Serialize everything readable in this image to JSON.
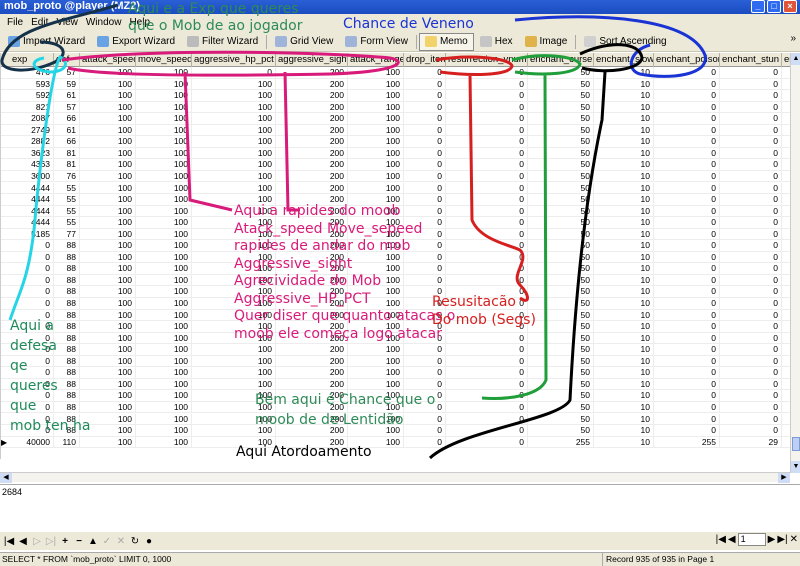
{
  "window": {
    "title": "mob_proto @player (MZ2)"
  },
  "menu": [
    "File",
    "Edit",
    "View",
    "Window",
    "Help"
  ],
  "toolbar": {
    "items": [
      "Import Wizard",
      "Export Wizard",
      "Filter Wizard",
      "Grid View",
      "Form View",
      "Memo",
      "Hex",
      "Image",
      "Sort Ascending"
    ],
    "chevron": "»"
  },
  "columns": [
    "exp",
    "def",
    "attack_speed",
    "move_speed",
    "aggressive_hp_pct",
    "aggressive_sight",
    "attack_range",
    "drop_item",
    "resurrection_vnum",
    "enchant_curse",
    "enchant_slow",
    "enchant_poison",
    "enchant_stun",
    "enc"
  ],
  "rows": [
    [
      "476",
      "57",
      "100",
      "100",
      "0",
      "200",
      "100",
      "0",
      "0",
      "50",
      "10",
      "0",
      "0"
    ],
    [
      "593",
      "59",
      "100",
      "100",
      "100",
      "200",
      "100",
      "0",
      "0",
      "50",
      "10",
      "0",
      "0"
    ],
    [
      "592",
      "61",
      "100",
      "100",
      "100",
      "200",
      "100",
      "0",
      "0",
      "50",
      "10",
      "0",
      "0"
    ],
    [
      "821",
      "57",
      "100",
      "100",
      "100",
      "200",
      "100",
      "0",
      "0",
      "50",
      "10",
      "0",
      "0"
    ],
    [
      "2087",
      "66",
      "100",
      "100",
      "100",
      "200",
      "100",
      "0",
      "0",
      "50",
      "10",
      "0",
      "0"
    ],
    [
      "2749",
      "61",
      "100",
      "100",
      "100",
      "200",
      "100",
      "0",
      "0",
      "50",
      "10",
      "0",
      "0"
    ],
    [
      "2882",
      "66",
      "100",
      "100",
      "100",
      "200",
      "100",
      "0",
      "0",
      "50",
      "10",
      "0",
      "0"
    ],
    [
      "3623",
      "81",
      "100",
      "100",
      "100",
      "200",
      "100",
      "0",
      "0",
      "50",
      "10",
      "0",
      "0"
    ],
    [
      "4363",
      "81",
      "100",
      "100",
      "100",
      "200",
      "100",
      "0",
      "0",
      "50",
      "10",
      "0",
      "0"
    ],
    [
      "3600",
      "76",
      "100",
      "100",
      "100",
      "200",
      "100",
      "0",
      "0",
      "50",
      "10",
      "0",
      "0"
    ],
    [
      "4444",
      "55",
      "100",
      "100",
      "100",
      "200",
      "100",
      "0",
      "0",
      "50",
      "10",
      "0",
      "0"
    ],
    [
      "4444",
      "55",
      "100",
      "100",
      "100",
      "200",
      "100",
      "0",
      "0",
      "50",
      "10",
      "0",
      "0"
    ],
    [
      "4444",
      "55",
      "100",
      "100",
      "100",
      "200",
      "100",
      "0",
      "0",
      "50",
      "10",
      "0",
      "0"
    ],
    [
      "4444",
      "55",
      "100",
      "100",
      "100",
      "200",
      "100",
      "0",
      "0",
      "50",
      "10",
      "0",
      "0"
    ],
    [
      "5185",
      "77",
      "100",
      "100",
      "100",
      "200",
      "100",
      "0",
      "0",
      "50",
      "10",
      "0",
      "0"
    ],
    [
      "0",
      "88",
      "100",
      "100",
      "100",
      "200",
      "100",
      "0",
      "0",
      "50",
      "10",
      "0",
      "0"
    ],
    [
      "0",
      "88",
      "100",
      "100",
      "100",
      "200",
      "100",
      "0",
      "0",
      "50",
      "10",
      "0",
      "0"
    ],
    [
      "0",
      "88",
      "100",
      "100",
      "100",
      "200",
      "100",
      "0",
      "0",
      "50",
      "10",
      "0",
      "0"
    ],
    [
      "0",
      "88",
      "100",
      "100",
      "100",
      "200",
      "100",
      "0",
      "0",
      "50",
      "10",
      "0",
      "0"
    ],
    [
      "0",
      "88",
      "100",
      "100",
      "100",
      "200",
      "100",
      "0",
      "0",
      "50",
      "10",
      "0",
      "0"
    ],
    [
      "0",
      "88",
      "100",
      "100",
      "100",
      "200",
      "100",
      "0",
      "0",
      "50",
      "10",
      "0",
      "0"
    ],
    [
      "0",
      "88",
      "100",
      "100",
      "100",
      "200",
      "100",
      "0",
      "0",
      "50",
      "10",
      "0",
      "0"
    ],
    [
      "0",
      "88",
      "100",
      "100",
      "100",
      "200",
      "100",
      "0",
      "0",
      "50",
      "10",
      "0",
      "0"
    ],
    [
      "0",
      "88",
      "100",
      "100",
      "100",
      "200",
      "100",
      "0",
      "0",
      "50",
      "10",
      "0",
      "0"
    ],
    [
      "0",
      "88",
      "100",
      "100",
      "100",
      "200",
      "100",
      "0",
      "0",
      "50",
      "10",
      "0",
      "0"
    ],
    [
      "0",
      "88",
      "100",
      "100",
      "100",
      "200",
      "100",
      "0",
      "0",
      "50",
      "10",
      "0",
      "0"
    ],
    [
      "0",
      "88",
      "100",
      "100",
      "100",
      "200",
      "100",
      "0",
      "0",
      "50",
      "10",
      "0",
      "0"
    ],
    [
      "0",
      "88",
      "100",
      "100",
      "100",
      "200",
      "100",
      "0",
      "0",
      "50",
      "10",
      "0",
      "0"
    ],
    [
      "0",
      "88",
      "100",
      "100",
      "100",
      "200",
      "100",
      "0",
      "0",
      "50",
      "10",
      "0",
      "0"
    ],
    [
      "0",
      "88",
      "100",
      "100",
      "100",
      "200",
      "100",
      "0",
      "0",
      "50",
      "10",
      "0",
      "0"
    ],
    [
      "0",
      "88",
      "100",
      "100",
      "100",
      "200",
      "100",
      "0",
      "0",
      "50",
      "10",
      "0",
      "0"
    ],
    [
      "0",
      "88",
      "100",
      "100",
      "100",
      "200",
      "100",
      "0",
      "0",
      "50",
      "10",
      "0",
      "0"
    ],
    [
      "40000",
      "110",
      "100",
      "100",
      "100",
      "200",
      "100",
      "0",
      "0",
      "255",
      "10",
      "255",
      "29"
    ]
  ],
  "memo": {
    "text": "2684"
  },
  "nav": {
    "page_input": "1"
  },
  "status": {
    "query": "SELECT * FROM `mob_proto` LIMIT 0, 1000",
    "record": "Record 935 of 935 in Page 1"
  },
  "annotations": {
    "exp": "Aqui e a Exp que queres\nque o Mob de ao jogador",
    "veneno": "Chance de Veneno",
    "rapides": "Aqui a rapides do moob\nAtack_speed Move_sepeed\nrapides de andar do mob\nAggressive_sight\nAgrecividade do Mob\nAggressive_HP_PCT\nQuer diser que quanto atacas o\nmoob ele começa logo atacar",
    "resusitacao": "Resusitacão\nDo mob (Segs)",
    "defesa": "Aqui a\ndefesa\nqe\nqueres\nque\nmob ten ha",
    "lentidao": "Bem aqui é Chance que o\nmoob de de Lentidão",
    "atordoamento": "Aqui Atordoamento"
  },
  "colors": {
    "titlebar": "#2a5fd6",
    "chrome": "#ece9d8",
    "anno_green": "#2e8b57",
    "anno_blue": "#1a33d4",
    "anno_pink": "#d81b7a",
    "anno_red": "#d62020",
    "anno_cyan": "#25d5e6"
  }
}
